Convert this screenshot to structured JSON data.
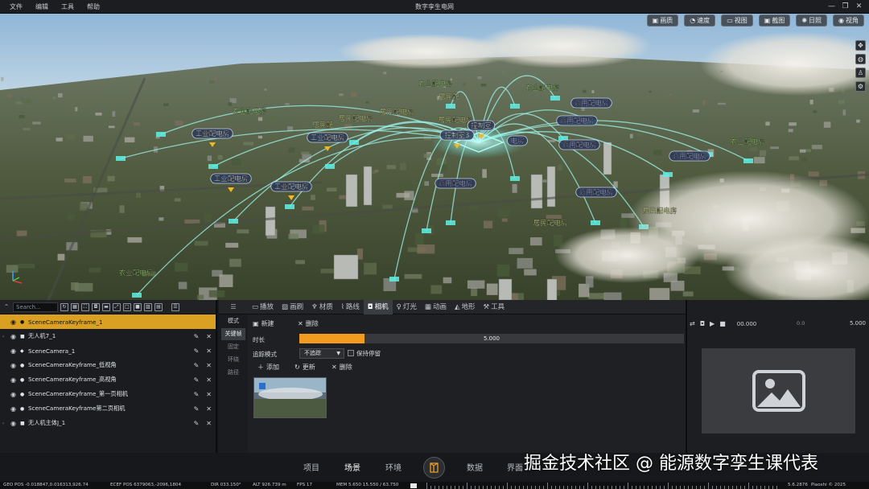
{
  "app": {
    "title": "数字孪生电网"
  },
  "menus": [
    "文件",
    "编辑",
    "工具",
    "帮助"
  ],
  "window_controls": [
    "—",
    "❐",
    "✕"
  ],
  "viewport_toolbar": [
    {
      "icon": "image-quality-icon",
      "glyph": "▣",
      "label": "画质"
    },
    {
      "icon": "speed-icon",
      "glyph": "◔",
      "label": "速度"
    },
    {
      "icon": "view-icon",
      "glyph": "▭",
      "label": "视图"
    },
    {
      "icon": "screenshot-icon",
      "glyph": "▣",
      "label": "截图"
    },
    {
      "icon": "sun-icon",
      "glyph": "✺",
      "label": "日照"
    },
    {
      "icon": "eye-icon",
      "glyph": "◉",
      "label": "视角"
    }
  ],
  "viewport_side": [
    {
      "icon": "move-icon",
      "glyph": "✥"
    },
    {
      "icon": "globe-icon",
      "glyph": "◍"
    },
    {
      "icon": "person-icon",
      "glyph": "♙"
    },
    {
      "icon": "settings-icon",
      "glyph": "⚙"
    }
  ],
  "scene_labels": [
    {
      "text": "农业配电房",
      "color": "#b8f08a"
    },
    {
      "text": "居民配",
      "color": "#e8f0a0"
    },
    {
      "text": "居民配电房",
      "color": "#e8f0a0"
    },
    {
      "text": "农业配电房",
      "color": "#b8f08a"
    },
    {
      "text": "居民配电房",
      "color": "#e8f0a0"
    },
    {
      "text": "居民配电房",
      "color": "#e8f0a0"
    },
    {
      "text": "农业配电房",
      "color": "#b8f08a"
    },
    {
      "text": "工业配电房",
      "color": "#ffffff"
    },
    {
      "text": "居民配",
      "color": "#e8f0a0"
    },
    {
      "text": "工业配电房",
      "color": "#ffffff"
    },
    {
      "text": "工业配电房",
      "color": "#ffffff"
    },
    {
      "text": "商用配电房",
      "color": "#c8c8ff"
    },
    {
      "text": "商用配电房",
      "color": "#c8c8ff"
    },
    {
      "text": "商用配电房",
      "color": "#c8c8ff"
    },
    {
      "text": "商用配电房",
      "color": "#c8c8ff"
    },
    {
      "text": "商用配电房",
      "color": "#c8c8ff"
    },
    {
      "text": "农业配电房",
      "color": "#b8f08a"
    },
    {
      "text": "工业配电房",
      "color": "#ffffff"
    },
    {
      "text": "居民配电房",
      "color": "#e8f0a0"
    },
    {
      "text": "居民配电房",
      "color": "#e8f0a0"
    },
    {
      "text": "商用配电房",
      "color": "#c8c8ff"
    },
    {
      "text": "农业配电房",
      "color": "#b8f08a"
    },
    {
      "text": "电房",
      "color": "#c8c8ff"
    },
    {
      "text": "控制室3",
      "color": "#ffffff"
    },
    {
      "text": "控制室",
      "color": "#ffffff"
    }
  ],
  "outliner": {
    "search_placeholder": "Search...",
    "items": [
      {
        "name": "SceneCameraKeyframe_1",
        "kind": "●",
        "arrow": "",
        "selected": true
      },
      {
        "name": "无人机7_1",
        "kind": "■",
        "arrow": "›",
        "selected": false
      },
      {
        "name": "SceneCamera_1",
        "kind": "◆",
        "arrow": "",
        "selected": false
      },
      {
        "name": "SceneCameraKeyframe_低视角",
        "kind": "●",
        "arrow": "",
        "selected": false
      },
      {
        "name": "SceneCameraKeyframe_高视角",
        "kind": "●",
        "arrow": "",
        "selected": false
      },
      {
        "name": "SceneCameraKeyframe_第一页相机",
        "kind": "●",
        "arrow": "",
        "selected": false
      },
      {
        "name": "SceneCameraKeyframe第二页相机",
        "kind": "●",
        "arrow": "",
        "selected": false
      },
      {
        "name": "无人机主体J_1",
        "kind": "■",
        "arrow": "›",
        "selected": false
      }
    ]
  },
  "tabs": [
    {
      "icon": "display-icon",
      "glyph": "▭",
      "label": "播放",
      "active": false
    },
    {
      "icon": "brush-icon",
      "glyph": "▨",
      "label": "画刷",
      "active": false
    },
    {
      "icon": "material-icon",
      "glyph": "♆",
      "label": "材质",
      "active": false
    },
    {
      "icon": "route-icon",
      "glyph": "⌇",
      "label": "路线",
      "active": false
    },
    {
      "icon": "camera-icon",
      "glyph": "◘",
      "label": "相机",
      "active": true
    },
    {
      "icon": "light-icon",
      "glyph": "♀",
      "label": "灯光",
      "active": false
    },
    {
      "icon": "animation-icon",
      "glyph": "▦",
      "label": "动画",
      "active": false
    },
    {
      "icon": "terrain-icon",
      "glyph": "◭",
      "label": "地形",
      "active": false
    },
    {
      "icon": "tool-icon",
      "glyph": "⚒",
      "label": "工具",
      "active": false
    }
  ],
  "camera_panel": {
    "mode_header": "模式",
    "modes": [
      {
        "label": "关键帧",
        "active": true
      },
      {
        "label": "固定",
        "active": false
      },
      {
        "label": "环绕",
        "active": false
      },
      {
        "label": "路径",
        "active": false
      }
    ],
    "new_label": "新建",
    "delete_label": "删除",
    "duration_label": "时长",
    "duration_value": "5.000",
    "duration_fraction": 0.17,
    "track_label": "追踪模式",
    "track_value": "不追踪",
    "keep_label": "保持停留",
    "add_label": "添加",
    "update_label": "更新",
    "delete2_label": "删除"
  },
  "preview": {
    "start": "00.000",
    "current": "0.0",
    "end": "5.000"
  },
  "nav": {
    "items": [
      {
        "label": "项目",
        "active": false
      },
      {
        "label": "场景",
        "active": true
      },
      {
        "label": "环境",
        "active": false
      },
      {
        "label": "数据",
        "active": false
      },
      {
        "label": "界面",
        "active": false
      }
    ],
    "watermark": "掘金技术社区 @ 能源数字孪生课代表"
  },
  "status": {
    "geo_pos": "GEO POS  -0.018847,0.016313,926.74",
    "ecef_pos": "ECEF POS  6379063,-2096,1804",
    "dir": "DIR  033.150°",
    "alt": "ALT  926.739 m",
    "fps": "FPS  17",
    "mem": "MEM  5.650  15.550 / 63.750",
    "version": "5.6.2876",
    "company": "Piaoshi © 2025"
  },
  "colors": {
    "accent": "#f19c20",
    "selected": "#d9a021",
    "panel": "#1e2023"
  }
}
